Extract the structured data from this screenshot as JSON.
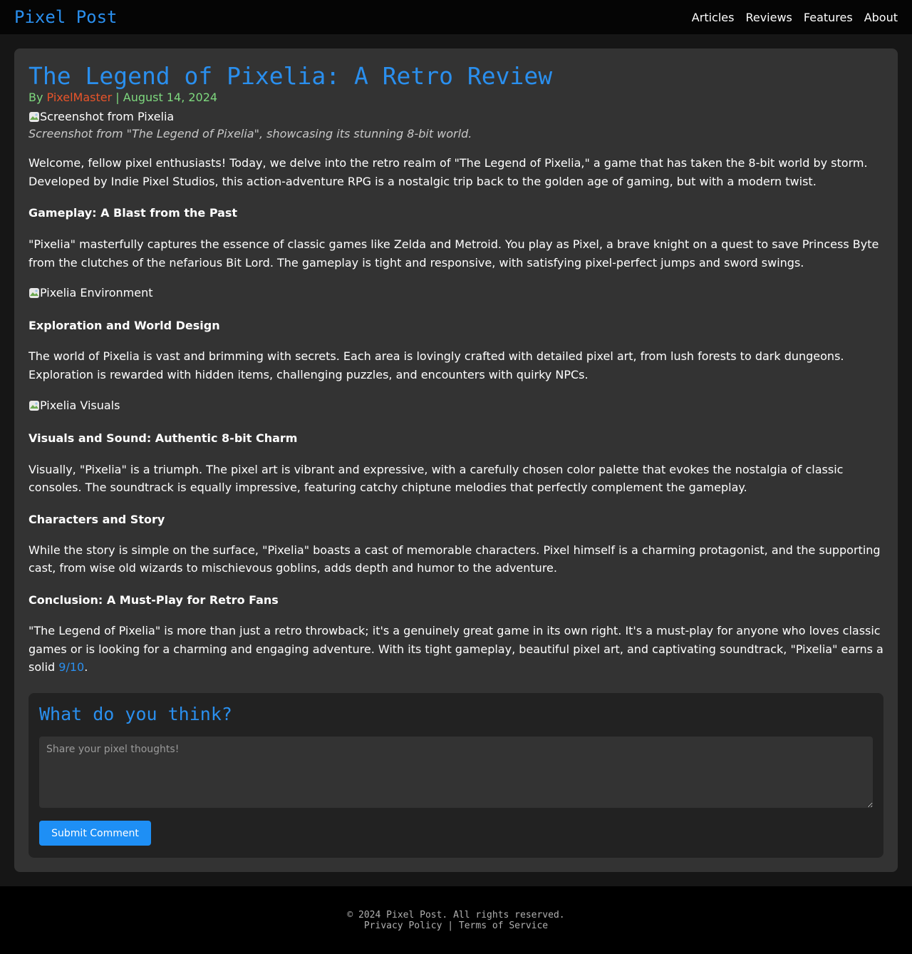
{
  "header": {
    "brand": "Pixel Post",
    "nav": [
      "Articles",
      "Reviews",
      "Features",
      "About"
    ]
  },
  "article": {
    "title": "The Legend of Pixelia: A Retro Review",
    "by_prefix": "By ",
    "author": "PixelMaster",
    "separator": " | ",
    "date": "August 14, 2024",
    "images": {
      "hero_alt": "Screenshot from Pixelia",
      "environment_alt": "Pixelia Environment",
      "visuals_alt": "Pixelia Visuals"
    },
    "hero_caption": "Screenshot from \"The Legend of Pixelia\", showcasing its stunning 8-bit world.",
    "intro": "Welcome, fellow pixel enthusiasts! Today, we delve into the retro realm of \"The Legend of Pixelia,\" a game that has taken the 8-bit world by storm. Developed by Indie Pixel Studios, this action-adventure RPG is a nostalgic trip back to the golden age of gaming, but with a modern twist.",
    "sections": [
      {
        "heading": "Gameplay: A Blast from the Past",
        "text": "\"Pixelia\" masterfully captures the essence of classic games like Zelda and Metroid. You play as Pixel, a brave knight on a quest to save Princess Byte from the clutches of the nefarious Bit Lord. The gameplay is tight and responsive, with satisfying pixel-perfect jumps and sword swings."
      },
      {
        "heading": "Exploration and World Design",
        "text": "The world of Pixelia is vast and brimming with secrets. Each area is lovingly crafted with detailed pixel art, from lush forests to dark dungeons. Exploration is rewarded with hidden items, challenging puzzles, and encounters with quirky NPCs."
      },
      {
        "heading": "Visuals and Sound: Authentic 8-bit Charm",
        "text": "Visually, \"Pixelia\" is a triumph. The pixel art is vibrant and expressive, with a carefully chosen color palette that evokes the nostalgia of classic consoles. The soundtrack is equally impressive, featuring catchy chiptune melodies that perfectly complement the gameplay."
      },
      {
        "heading": "Characters and Story",
        "text": "While the story is simple on the surface, \"Pixelia\" boasts a cast of memorable characters. Pixel himself is a charming protagonist, and the supporting cast, from wise old wizards to mischievous goblins, adds depth and humor to the adventure."
      },
      {
        "heading": "Conclusion: A Must-Play for Retro Fans",
        "text_before_score": "\"The Legend of Pixelia\" is more than just a retro throwback; it's a genuinely great game in its own right. It's a must-play for anyone who loves classic games or is looking for a charming and engaging adventure. With its tight gameplay, beautiful pixel art, and captivating soundtrack, \"Pixelia\" earns a solid ",
        "score": "9/10",
        "text_after_score": "."
      }
    ]
  },
  "comments": {
    "heading": "What do you think?",
    "placeholder": "Share your pixel thoughts!",
    "submit_label": "Submit Comment"
  },
  "footer": {
    "copyright": "© 2024 Pixel Post. All rights reserved.",
    "privacy": "Privacy Policy",
    "separator": " | ",
    "terms": "Terms of Service"
  },
  "colors": {
    "accent": "#2a8fee",
    "author": "#e8542a",
    "byline": "#7ed87e",
    "card": "#333333",
    "comment_box": "#222222"
  },
  "icons": {
    "broken_image": "broken-image-icon"
  }
}
